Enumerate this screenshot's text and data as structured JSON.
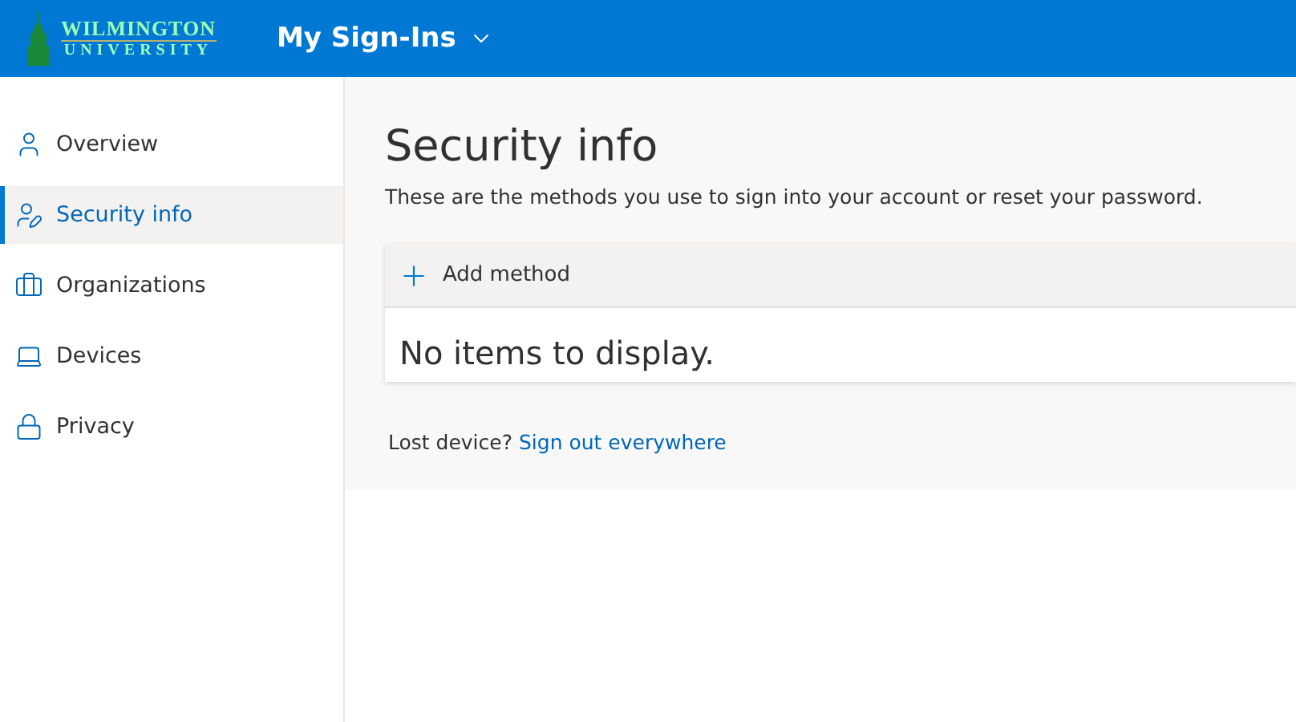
{
  "header": {
    "logo": {
      "name": "WILMINGTON",
      "subtitle": "UNIVERSITY"
    },
    "app_title": "My Sign-Ins"
  },
  "sidebar": {
    "items": [
      {
        "label": "Overview",
        "selected": false
      },
      {
        "label": "Security info",
        "selected": true
      },
      {
        "label": "Organizations",
        "selected": false
      },
      {
        "label": "Devices",
        "selected": false
      },
      {
        "label": "Privacy",
        "selected": false
      }
    ]
  },
  "main": {
    "title": "Security info",
    "description": "These are the methods you use to sign into your account or reset your password.",
    "add_button": "Add method",
    "empty_message": "No items to display.",
    "lost_device": {
      "text": "Lost device?",
      "link": "Sign out everywhere"
    }
  }
}
